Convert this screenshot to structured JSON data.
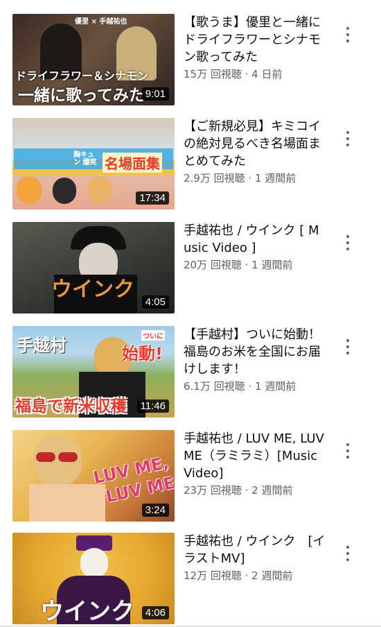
{
  "videos": [
    {
      "title": "【歌うま】優里と一緒にドライフラワーとシナモン歌ってみた",
      "views": "15万 回視聴",
      "age": "4 日前",
      "duration": "9:01",
      "thumb_overlay": [
        "優里 × 手越祐也",
        "ドライフラワー＆シナモン",
        "一緒に歌ってみた"
      ]
    },
    {
      "title": "【ご新規必見】キミコイの絶対見るべき名場面まとめてみた",
      "views": "2.9万 回視聴",
      "age": "1 週間前",
      "duration": "17:34",
      "thumb_overlay": [
        "胸キュン 爆笑",
        "名場面集"
      ]
    },
    {
      "title": "手越祐也 / ウインク [ Music Video ]",
      "views": "20万 回視聴",
      "age": "1 週間前",
      "duration": "4:05",
      "thumb_overlay": [
        "ウインク"
      ]
    },
    {
      "title": "【手越村】ついに始動！福島のお米を全国にお届けします！",
      "views": "6.1万 回視聴",
      "age": "1 週間前",
      "duration": "11:46",
      "thumb_overlay": [
        "手越村",
        "ついに",
        "始動!",
        "福島で新米収穫"
      ]
    },
    {
      "title": "手越祐也 / LUV ME, LUV ME（ラミラミ）[Music Video]",
      "views": "23万 回視聴",
      "age": "2 週間前",
      "duration": "3:24",
      "thumb_overlay": [
        "LUV ME,",
        "LUV ME"
      ]
    },
    {
      "title": "手越祐也 / ウインク　[イラストMV]",
      "views": "12万 回視聴",
      "age": "2 週間前",
      "duration": "4:06",
      "thumb_overlay": [
        "ウインク"
      ]
    }
  ],
  "separator": " · ",
  "icons": {
    "more": "more-vert-icon"
  }
}
